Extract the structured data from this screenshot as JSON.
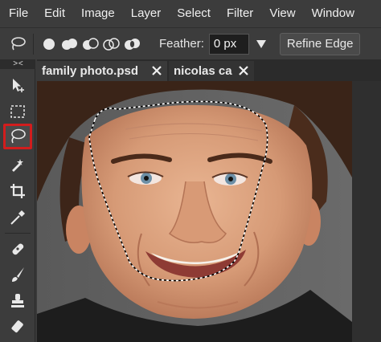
{
  "menu": {
    "items": [
      "File",
      "Edit",
      "Image",
      "Layer",
      "Select",
      "Filter",
      "View",
      "Window"
    ]
  },
  "options": {
    "tool_icon": "lasso-icon",
    "selection_modes": [
      "new-selection-icon",
      "add-to-selection-icon",
      "subtract-from-selection-icon",
      "intersect-selection-icon",
      "exclude-selection-icon"
    ],
    "feather_label": "Feather:",
    "feather_value": "0 px",
    "refine_edge_label": "Refine Edge"
  },
  "toolbox": {
    "collapse_label": "> <",
    "tools": [
      "move-tool-icon",
      "marquee-tool-icon",
      "lasso-tool-icon",
      "quick-selection-tool-icon",
      "crop-tool-icon",
      "eyedropper-tool-icon",
      "healing-brush-tool-icon",
      "brush-tool-icon",
      "stamp-tool-icon",
      "eraser-tool-icon"
    ],
    "active_tool": "lasso-tool-icon"
  },
  "tabs": [
    {
      "label": "family photo.psd"
    },
    {
      "label": "nicolas ca"
    }
  ],
  "colors": {
    "active_tool_outline": "#d21d1d",
    "chrome": "#3c3c3c"
  }
}
